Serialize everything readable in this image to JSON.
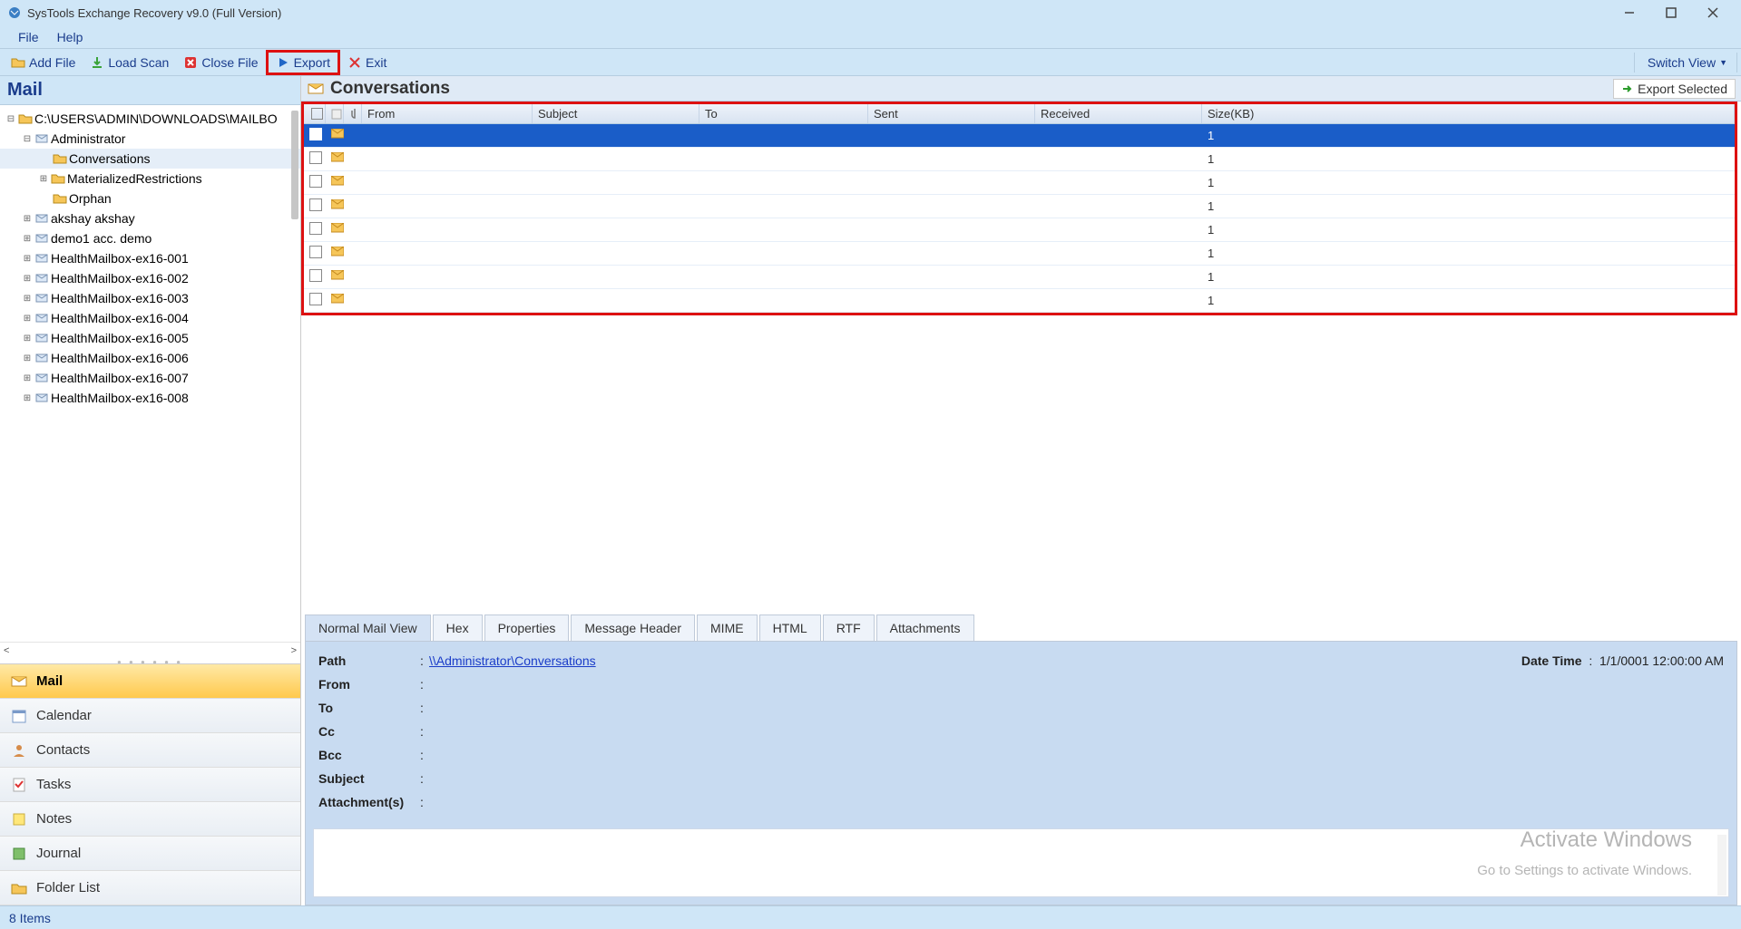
{
  "titlebar": {
    "text": "SysTools Exchange Recovery v9.0 (Full Version)"
  },
  "menubar": {
    "file": "File",
    "help": "Help"
  },
  "toolbar": {
    "add_file": "Add File",
    "load_scan": "Load Scan",
    "close_file": "Close File",
    "export": "Export",
    "exit": "Exit",
    "switch_view": "Switch View"
  },
  "sidebar": {
    "title": "Mail",
    "root_path": "C:\\USERS\\ADMIN\\DOWNLOADS\\MAILBO",
    "tree": {
      "administrator": "Administrator",
      "conversations": "Conversations",
      "materialized": "MaterializedRestrictions",
      "orphan": "Orphan",
      "akshay": "akshay akshay",
      "demo1": "demo1 acc. demo",
      "hmb1": "HealthMailbox-ex16-001",
      "hmb2": "HealthMailbox-ex16-002",
      "hmb3": "HealthMailbox-ex16-003",
      "hmb4": "HealthMailbox-ex16-004",
      "hmb5": "HealthMailbox-ex16-005",
      "hmb6": "HealthMailbox-ex16-006",
      "hmb7": "HealthMailbox-ex16-007",
      "hmb8": "HealthMailbox-ex16-008"
    },
    "nav": {
      "mail": "Mail",
      "calendar": "Calendar",
      "contacts": "Contacts",
      "tasks": "Tasks",
      "notes": "Notes",
      "journal": "Journal",
      "folders": "Folder List"
    }
  },
  "main": {
    "title": "Conversations",
    "export_selected": "Export Selected",
    "columns": {
      "from": "From",
      "subject": "Subject",
      "to": "To",
      "sent": "Sent",
      "received": "Received",
      "size": "Size(KB)"
    },
    "rows": [
      {
        "size": "1"
      },
      {
        "size": "1"
      },
      {
        "size": "1"
      },
      {
        "size": "1"
      },
      {
        "size": "1"
      },
      {
        "size": "1"
      },
      {
        "size": "1"
      },
      {
        "size": "1"
      }
    ],
    "tabs": {
      "normal": "Normal Mail View",
      "hex": "Hex",
      "properties": "Properties",
      "msg_header": "Message Header",
      "mime": "MIME",
      "html": "HTML",
      "rtf": "RTF",
      "attachments": "Attachments"
    },
    "detail": {
      "path_label": "Path",
      "path_value": "\\\\Administrator\\Conversations",
      "datetime_label": "Date Time",
      "datetime_value": "1/1/0001 12:00:00 AM",
      "from_label": "From",
      "to_label": "To",
      "cc_label": "Cc",
      "bcc_label": "Bcc",
      "subject_label": "Subject",
      "attachments_label": "Attachment(s)"
    },
    "watermark1": "Activate Windows",
    "watermark2": "Go to Settings to activate Windows."
  },
  "statusbar": {
    "text": "8 Items"
  }
}
